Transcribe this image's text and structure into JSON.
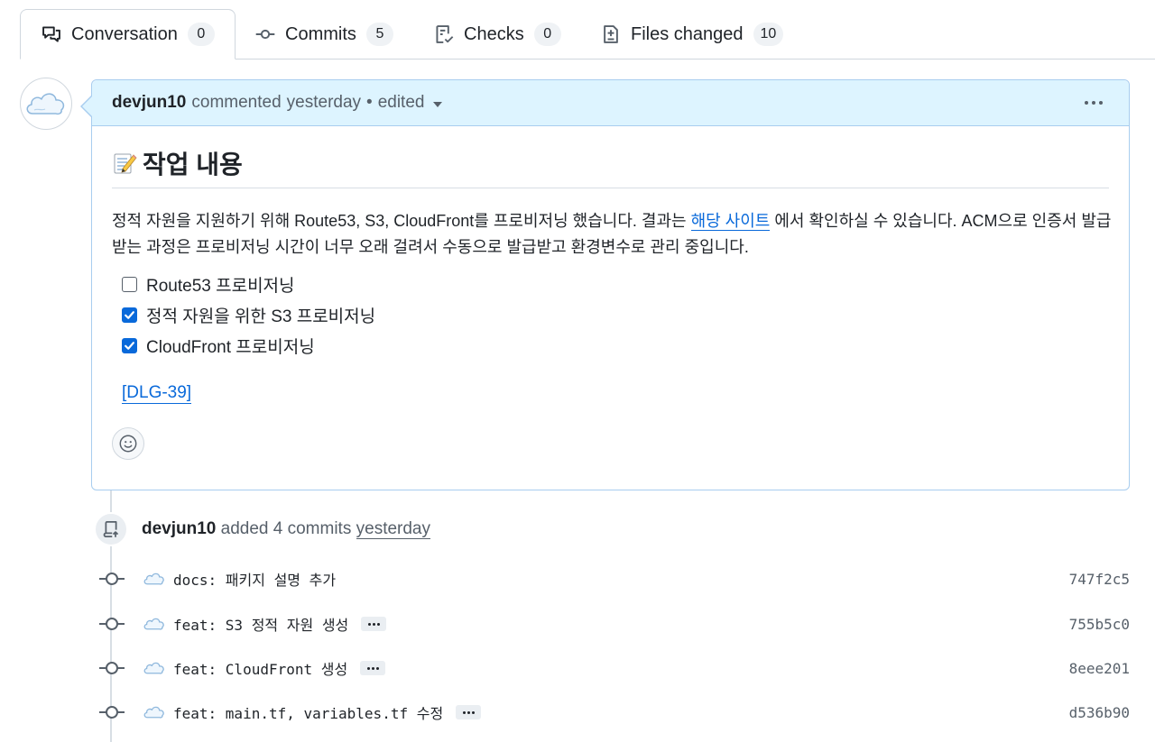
{
  "tabs": [
    {
      "label": "Conversation",
      "count": "0",
      "icon": "comment-discussion-icon",
      "selected": true
    },
    {
      "label": "Commits",
      "count": "5",
      "icon": "git-commit-icon"
    },
    {
      "label": "Checks",
      "count": "0",
      "icon": "checklist-icon"
    },
    {
      "label": "Files changed",
      "count": "10",
      "icon": "file-diff-icon"
    }
  ],
  "comment": {
    "author": "devjun10",
    "action": "commented",
    "time": "yesterday",
    "dot": "•",
    "edited": "edited",
    "heading_emoji": "memo-icon",
    "heading": "작업 내용",
    "para_before_link": "정적 자원을 지원하기 위해 Route53, S3, CloudFront를 프로비저닝 했습니다. 결과는 ",
    "link_text": "해당 사이트",
    "para_after_link": " 에서 확인하실 수 있습니다. ACM으로 인증서 발급받는 과정은 프로비저닝 시간이 너무 오래 걸려서 수동으로 발급받고 환경변수로 관리 중입니다.",
    "tasks": [
      {
        "label": "Route53 프로비저닝",
        "checked": false
      },
      {
        "label": "정적 자원을 위한 S3 프로비저닝",
        "checked": true
      },
      {
        "label": "CloudFront 프로비저닝",
        "checked": true
      }
    ],
    "ticket": "[DLG-39]"
  },
  "event": {
    "author": "devjun10",
    "action": "added 4 commits",
    "time": "yesterday"
  },
  "commits": [
    {
      "message": "docs: 패키지 설명 추가",
      "sha": "747f2c5",
      "has_more": false
    },
    {
      "message": "feat: S3 정적 자원 생성",
      "sha": "755b5c0",
      "has_more": true
    },
    {
      "message": "feat: CloudFront 생성",
      "sha": "8eee201",
      "has_more": true
    },
    {
      "message": "feat: main.tf, variables.tf 수정",
      "sha": "d536b90",
      "has_more": true
    }
  ],
  "colors": {
    "accent": "#0969da",
    "header_bg": "#ddf4ff",
    "border": "#d0d7de"
  }
}
